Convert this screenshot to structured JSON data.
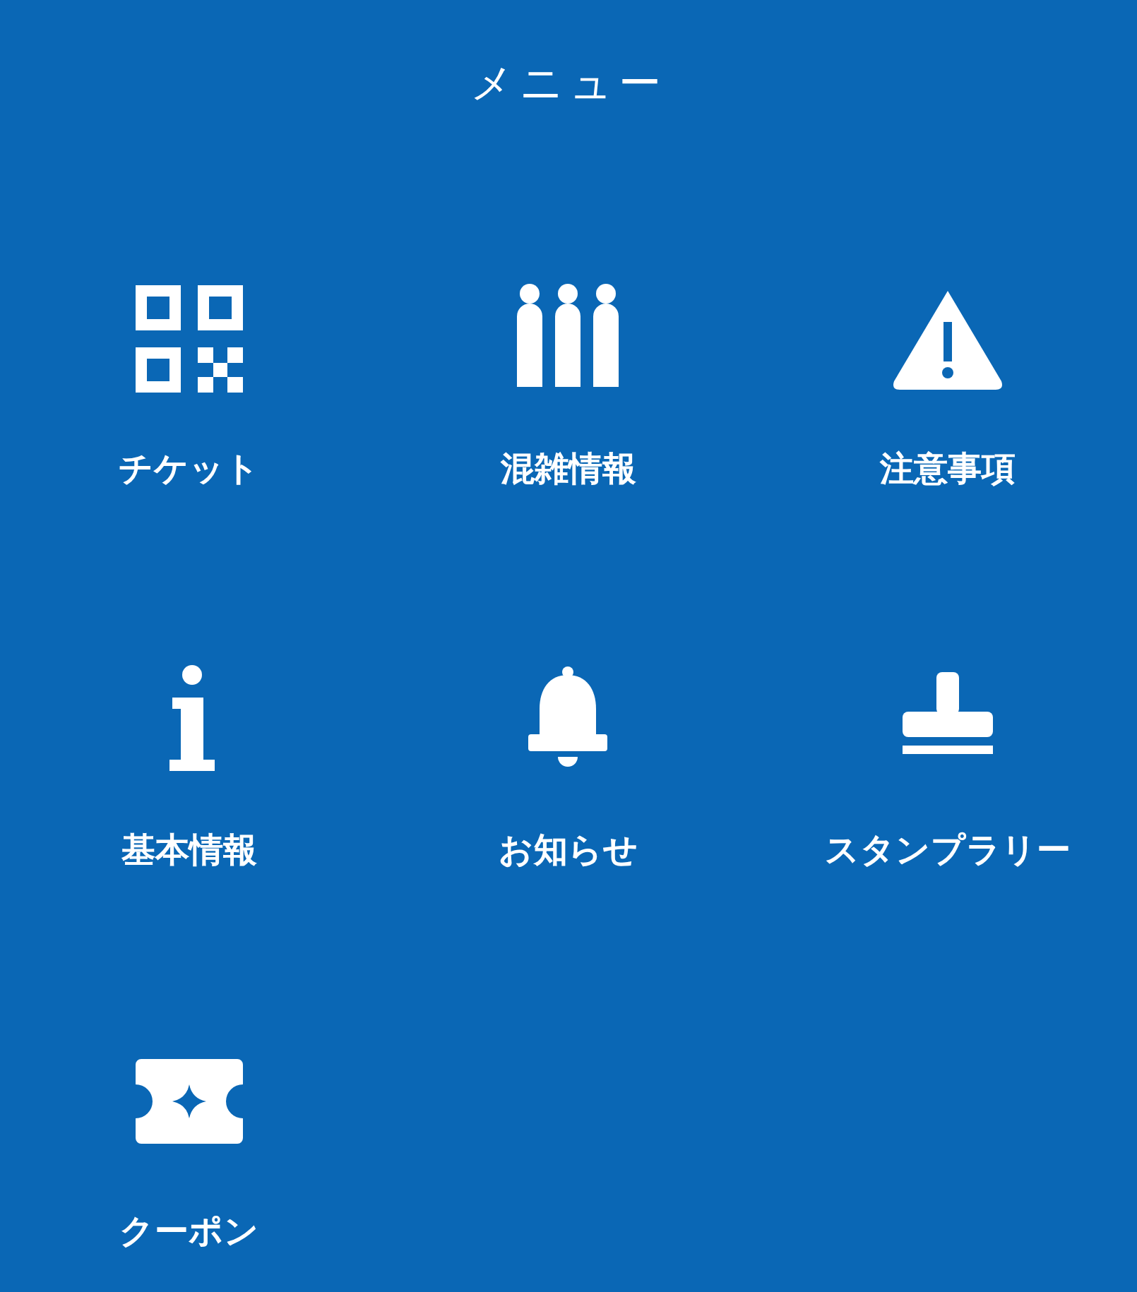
{
  "header": {
    "title": "メニュー"
  },
  "menu_items": [
    {
      "label": "チケット",
      "kind": "qr"
    },
    {
      "label": "混雑情報",
      "kind": "people"
    },
    {
      "label": "注意事項",
      "kind": "warning"
    },
    {
      "label": "基本情報",
      "kind": "info"
    },
    {
      "label": "お知らせ",
      "kind": "bell"
    },
    {
      "label": "スタンプラリー",
      "kind": "stamp"
    },
    {
      "label": "クーポン",
      "kind": "coupon"
    }
  ]
}
